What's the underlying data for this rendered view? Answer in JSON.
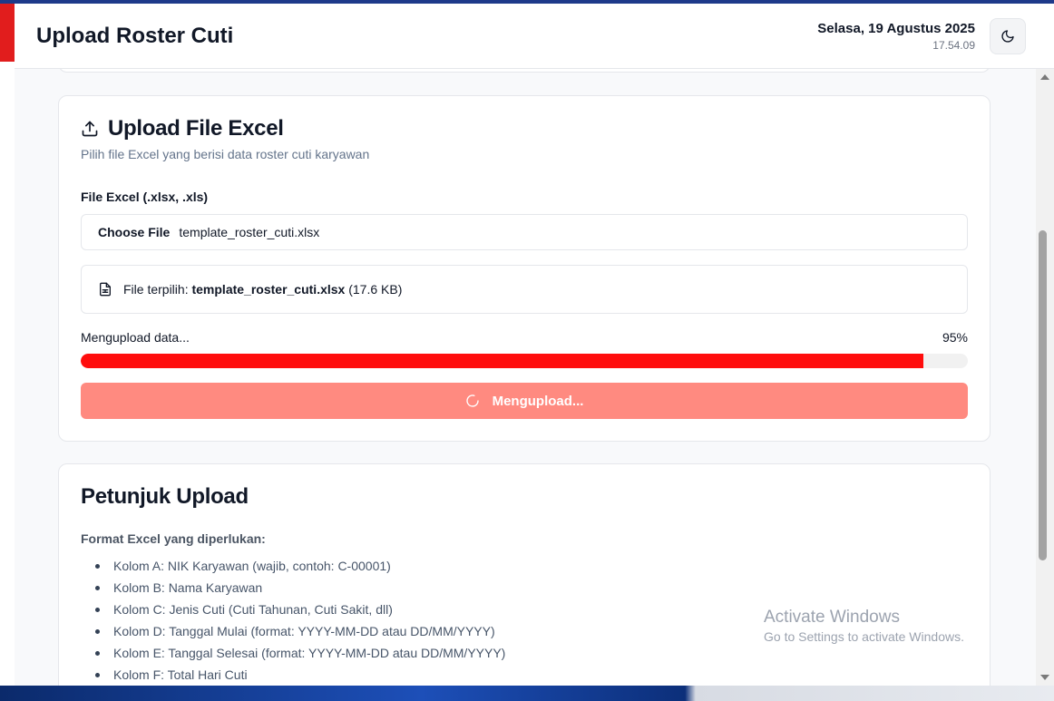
{
  "header": {
    "title": "Upload Roster Cuti",
    "date": "Selasa, 19 Agustus 2025",
    "time": "17.54.09",
    "theme_icon": "moon-icon"
  },
  "upload_card": {
    "title": "Upload File Excel",
    "subtitle": "Pilih file Excel yang berisi data roster cuti karyawan",
    "field_label": "File Excel (.xlsx, .xls)",
    "choose_button": "Choose File",
    "file_name": "template_roster_cuti.xlsx",
    "selected_prefix": "File terpilih:",
    "selected_name": "template_roster_cuti.xlsx",
    "selected_size": "(17.6 KB)",
    "progress_label": "Mengupload data...",
    "progress_percent_text": "95%",
    "progress_value": 0.95,
    "button_label": "Mengupload..."
  },
  "instructions_card": {
    "title": "Petunjuk Upload",
    "format_title": "Format Excel yang diperlukan:",
    "items": [
      "Kolom A: NIK Karyawan (wajib, contoh: C-00001)",
      "Kolom B: Nama Karyawan",
      "Kolom C: Jenis Cuti (Cuti Tahunan, Cuti Sakit, dll)",
      "Kolom D: Tanggal Mulai (format: YYYY-MM-DD atau DD/MM/YYYY)",
      "Kolom E: Tanggal Selesai (format: YYYY-MM-DD atau DD/MM/YYYY)",
      "Kolom F: Total Hari Cuti"
    ]
  },
  "watermark": {
    "line1": "Activate Windows",
    "line2": "Go to Settings to activate Windows."
  },
  "colors": {
    "accent_red": "#e11d1d",
    "progress_fill": "#ff0d0d",
    "button_disabled": "#ff8a80"
  }
}
